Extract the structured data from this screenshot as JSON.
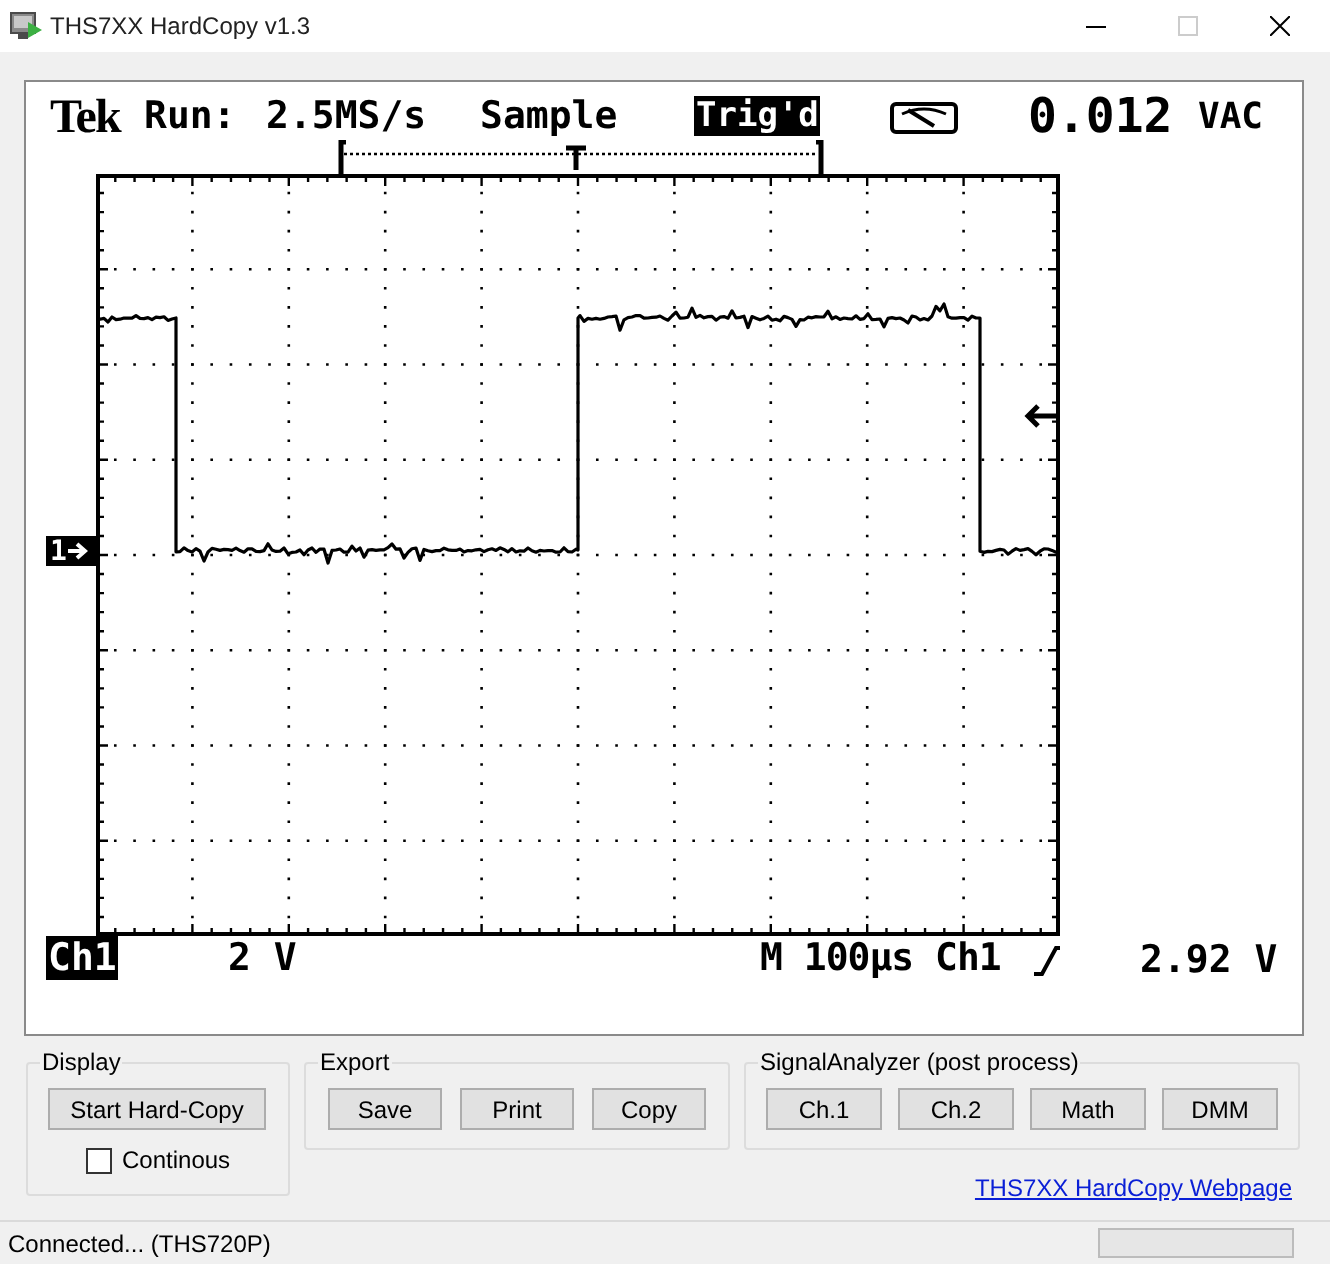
{
  "window": {
    "title": "THS7XX HardCopy v1.3"
  },
  "scope_display": {
    "header": {
      "brand": "Tek",
      "run_state": "Run:",
      "sample_rate": "2.5MS/s",
      "acquire_mode": "Sample",
      "trigger_status": "Trig'd",
      "measurement_value": "0.012",
      "measurement_unit": "VAC"
    },
    "ground_marker": "1",
    "footer": {
      "channel": "Ch1",
      "scale": "2 V",
      "timebase": "M 100µs Ch1",
      "trigger_level": "2.92 V"
    }
  },
  "groups": [
    {
      "title": "Display",
      "items": [
        {
          "kind": "button",
          "label": "Start Hard-Copy"
        },
        {
          "kind": "checkbox",
          "label": "Continous",
          "checked": false
        }
      ]
    },
    {
      "title": "Export",
      "items": [
        {
          "kind": "button",
          "label": "Save"
        },
        {
          "kind": "button",
          "label": "Print"
        },
        {
          "kind": "button",
          "label": "Copy"
        }
      ]
    },
    {
      "title": "SignalAnalyzer (post process)",
      "items": [
        {
          "kind": "button",
          "label": "Ch.1"
        },
        {
          "kind": "button",
          "label": "Ch.2"
        },
        {
          "kind": "button",
          "label": "Math"
        },
        {
          "kind": "button",
          "label": "DMM"
        }
      ]
    }
  ],
  "link": "THS7XX HardCopy Webpage",
  "status_bar": {
    "text": "Connected... (THS720P)",
    "progress": {
      "level": 0
    }
  }
}
